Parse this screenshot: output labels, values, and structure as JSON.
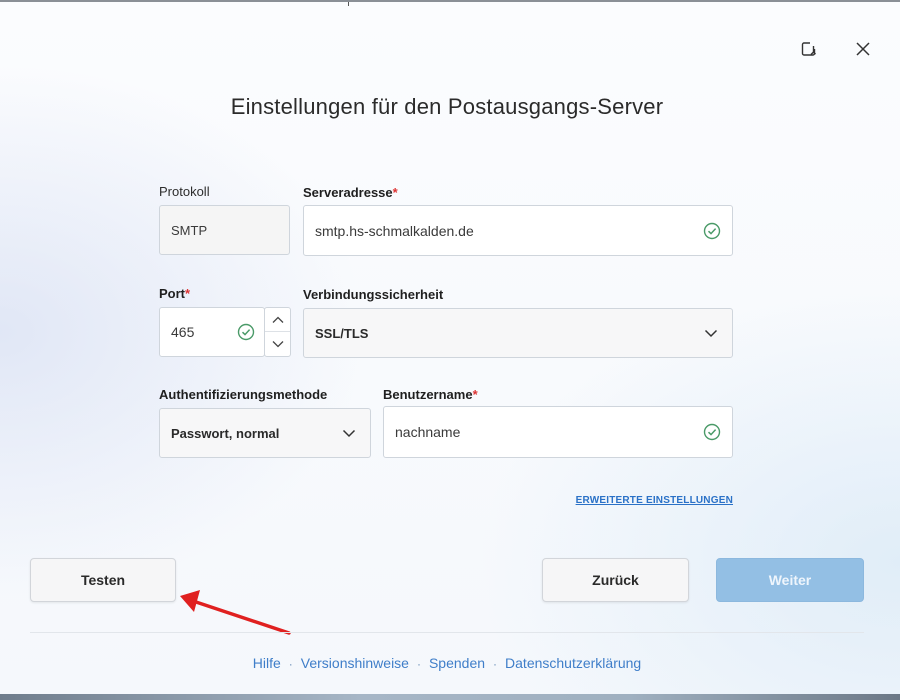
{
  "dialog": {
    "title": "Einstellungen für den Postausgangs-Server"
  },
  "fields": {
    "protocol": {
      "label": "Protokoll",
      "value": "SMTP"
    },
    "server": {
      "label": "Serveradresse",
      "required_mark": "*",
      "value": "smtp.hs-schmalkalden.de"
    },
    "port": {
      "label": "Port",
      "required_mark": "*",
      "value": "465"
    },
    "security": {
      "label": "Verbindungssicherheit",
      "value": "SSL/TLS"
    },
    "auth": {
      "label": "Authentifizierungsmethode",
      "value": "Passwort, normal"
    },
    "username": {
      "label": "Benutzername",
      "required_mark": "*",
      "value": "nachname"
    }
  },
  "advanced_link": "ERWEITERTE EINSTELLUNGEN",
  "buttons": {
    "test": "Testen",
    "back": "Zurück",
    "next": "Weiter"
  },
  "footer": {
    "links": [
      "Hilfe",
      "Versionshinweise",
      "Spenden",
      "Datenschutzerklärung"
    ],
    "separator": "·"
  },
  "colors": {
    "accent": "#3f7ec9",
    "valid": "#4a9a68",
    "annotation_arrow": "#e02020",
    "primary_button": "#93bfe4"
  },
  "icons": [
    "restore-window-icon",
    "close-icon",
    "checkmark-circle-icon",
    "chevron-down-icon",
    "chevron-up-icon",
    "red-arrow-annotation"
  ]
}
